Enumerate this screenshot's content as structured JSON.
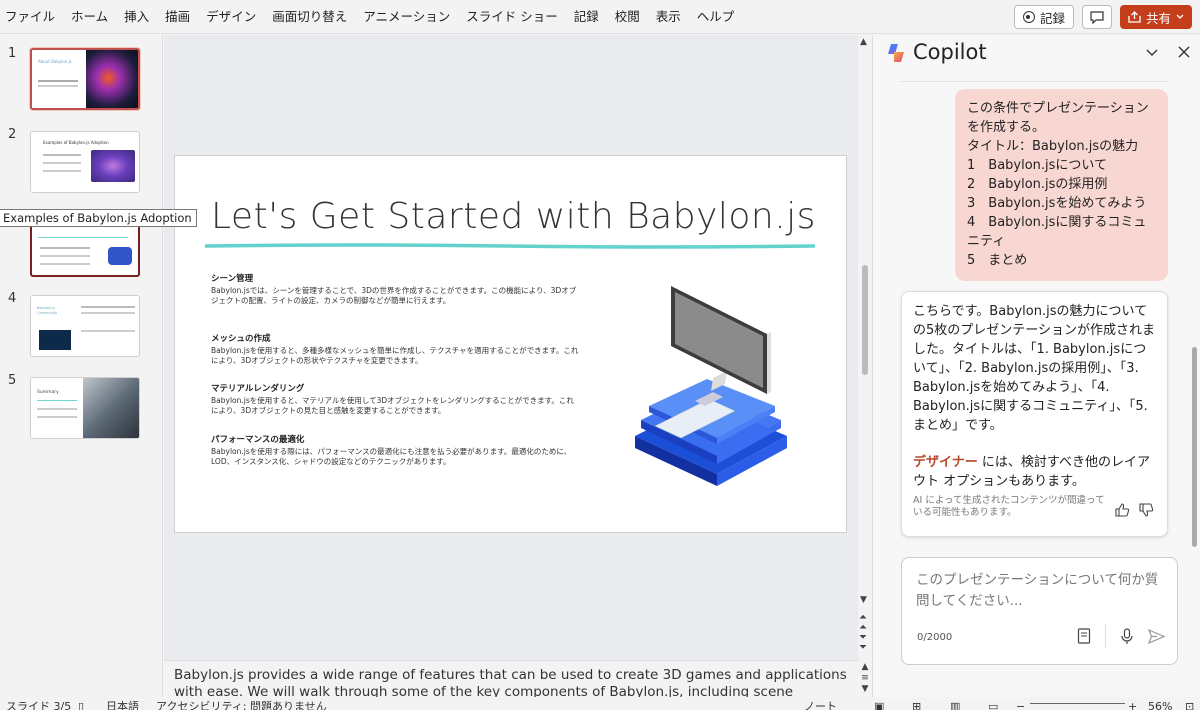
{
  "menu": [
    "ファイル",
    "ホーム",
    "挿入",
    "描画",
    "デザイン",
    "画面切り替え",
    "アニメーション",
    "スライド ショー",
    "記録",
    "校閲",
    "表示",
    "ヘルプ"
  ],
  "toolbar": {
    "record_label": "記録",
    "share_label": "共有",
    "accent": "#c43e1c"
  },
  "thumbnails": [
    {
      "num": "1",
      "title": "About Babylon.js"
    },
    {
      "num": "2",
      "title": "Examples of Babylon.js Adoption"
    },
    {
      "num": "3",
      "title": ""
    },
    {
      "num": "4",
      "title": "Babylon.js Community"
    },
    {
      "num": "5",
      "title": "Summary"
    }
  ],
  "tooltip": "Examples of Babylon.js Adoption",
  "slide": {
    "title": "Let's Get Started with Babylon.js",
    "sections": [
      {
        "heading": "シーン管理",
        "body": "Babylon.jsでは、シーンを管理することで、3Dの世界を作成することができます。この機能により、3Dオブジェクトの配置、ライトの設定、カメラの制御などが簡単に行えます。"
      },
      {
        "heading": "メッシュの作成",
        "body": "Babylon.jsを使用すると、多種多様なメッシュを簡単に作成し、テクスチャを適用することができます。これにより、3Dオブジェクトの形状やテクスチャを変更できます。"
      },
      {
        "heading": "マテリアルレンダリング",
        "body": "Babylon.jsを使用すると、マテリアルを使用して3Dオブジェクトをレンダリングすることができます。これにより、3Dオブジェクトの見た目と感触を変更することができます。"
      },
      {
        "heading": "パフォーマンスの最適化",
        "body": "Babylon.jsを使用する際には、パフォーマンスの最適化にも注意を払う必要があります。最適化のために、LOD、インスタンス化、シャドウの設定などのテクニックがあります。"
      }
    ]
  },
  "notes": "Babylon.js provides a wide range of features that can be used to create 3D games and applications with ease. We will walk through some of the key components of Babylon.js, including scene",
  "status": {
    "slide": "スライド 3/5",
    "language": "日本語",
    "accessibility": "アクセシビリティ: 問題ありません",
    "notes_label": "ノート",
    "zoom": "56%"
  },
  "copilot": {
    "title": "Copilot",
    "user_message": [
      "この条件でプレゼンテーションを作成する。",
      "タイトル：Babylon.jsの魅力",
      "1　Babylon.jsについて",
      "2　Babylon.jsの採用例",
      "3　Babylon.jsを始めてみよう",
      "4　Babylon.jsに関するコミュニティ",
      "5　まとめ"
    ],
    "bot_message": "こちらです。Babylon.jsの魅力についての5枚のプレゼンテーションが作成されました。タイトルは、「1. Babylon.jsについて」、「2. Babylon.jsの採用例」、「3. Babylon.jsを始めてみよう」、「4. Babylon.jsに関するコミュニティ」、「5. まとめ」です。",
    "designer_word": "デザイナー",
    "designer_rest": " には、検討すべき他のレイアウト オプションもあります。",
    "ai_note": "AI によって生成されたコンテンツが間違っている可能性もあります。",
    "input_placeholder": "このプレゼンテーションについて何か質問してください...",
    "counter": "0/2000"
  }
}
